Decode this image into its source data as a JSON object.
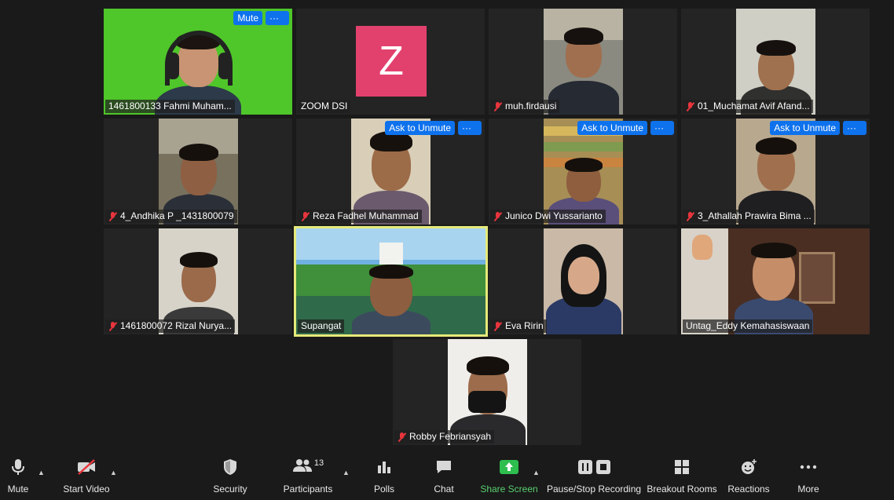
{
  "participants": [
    {
      "name": "1461800133 Fahmi Muham...",
      "muted": false,
      "overlay": [
        "Mute",
        "···"
      ]
    },
    {
      "name": "ZOOM DSI",
      "muted": false,
      "avatar_letter": "Z",
      "avatar_color": "#e2416d"
    },
    {
      "name": "muh.firdausi",
      "muted": true
    },
    {
      "name": "01_Muchamat Avif Afand...",
      "muted": true
    },
    {
      "name": "4_Andhika P _1431800079",
      "muted": true
    },
    {
      "name": "Reza Fadhel Muhammad",
      "muted": true,
      "overlay": [
        "Ask to Unmute",
        "···"
      ]
    },
    {
      "name": "Junico Dwi Yussarianto",
      "muted": true,
      "overlay": [
        "Ask to Unmute",
        "···"
      ]
    },
    {
      "name": "3_Athallah Prawira Bima ...",
      "muted": true,
      "overlay": [
        "Ask to Unmute",
        "···"
      ]
    },
    {
      "name": "1461800072 Rizal Nurya...",
      "muted": true
    },
    {
      "name": "Supangat",
      "muted": false,
      "active_speaker": true
    },
    {
      "name": "Eva Ririn",
      "muted": true
    },
    {
      "name": "Untag_Eddy Kemahasiswaan",
      "muted": false
    },
    {
      "name": "Robby Febriansyah",
      "muted": true
    }
  ],
  "toolbar": {
    "mute": "Mute",
    "start_video": "Start Video",
    "security": "Security",
    "participants": "Participants",
    "participants_count": "13",
    "polls": "Polls",
    "chat": "Chat",
    "share_screen": "Share Screen",
    "recording": "Pause/Stop Recording",
    "breakout": "Breakout Rooms",
    "reactions": "Reactions",
    "more": "More"
  },
  "colors": {
    "accent": "#0e72ed",
    "share_green": "#2dbe4e",
    "muted_red": "#e8353d",
    "active_speaker": "#e6e97a"
  }
}
